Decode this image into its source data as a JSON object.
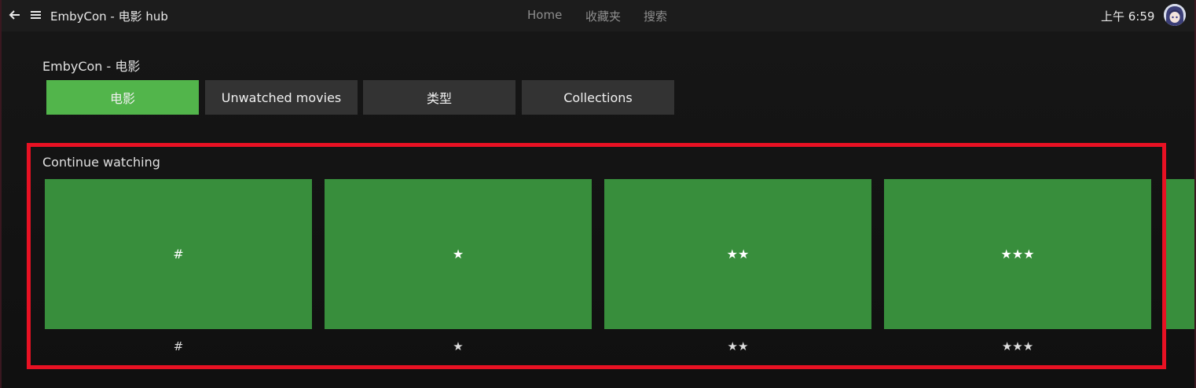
{
  "topbar": {
    "title": "EmbyCon - 电影 hub",
    "nav": [
      "Home",
      "收藏夹",
      "搜索"
    ],
    "clock": "上午 6:59"
  },
  "section": {
    "title": "EmbyCon - 电影",
    "tabs": [
      {
        "label": "电影",
        "active": true
      },
      {
        "label": "Unwatched movies",
        "active": false
      },
      {
        "label": "类型",
        "active": false
      },
      {
        "label": "Collections",
        "active": false
      }
    ]
  },
  "continue_watching": {
    "title": "Continue watching",
    "cards": [
      {
        "poster_text": "#",
        "label": "#"
      },
      {
        "poster_text": "★",
        "label": "★"
      },
      {
        "poster_text": "★★",
        "label": "★★"
      },
      {
        "poster_text": "★★★",
        "label": "★★★"
      }
    ]
  },
  "colors": {
    "accent": "#52b54b",
    "card": "#388e3c",
    "highlight": "#e81123"
  }
}
